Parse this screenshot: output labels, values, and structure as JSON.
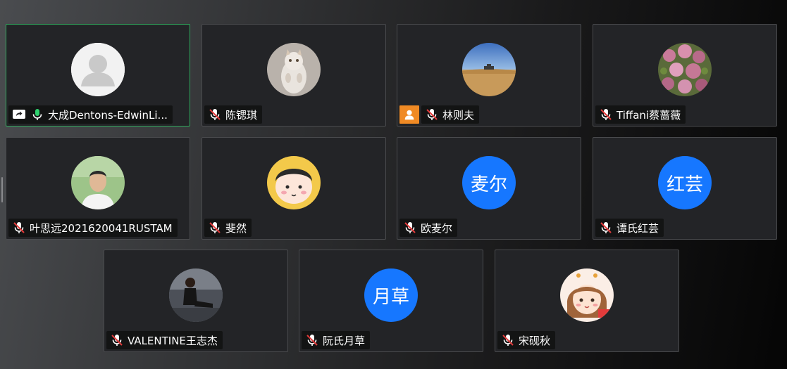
{
  "colors": {
    "tile_bg": "#232427",
    "active_border": "#2fa85c",
    "avatar_blue": "#1677ff",
    "host_orange": "#f08a24",
    "mic_green": "#2fd16e",
    "muted_red": "#e23b3b"
  },
  "participants": [
    {
      "name": "大成Dentons-EdwinLi...",
      "avatar_type": "default-user",
      "mic": "on",
      "sharing": true,
      "active": true
    },
    {
      "name": "陈锶琪",
      "avatar_type": "photo-cat",
      "mic": "muted"
    },
    {
      "name": "林则夫",
      "avatar_type": "photo-desert",
      "mic": "muted",
      "host_badge": true
    },
    {
      "name": "Tiffani蔡蔷薇",
      "avatar_type": "photo-flowers",
      "mic": "muted"
    },
    {
      "name": "叶思远2021620041RUSTAM",
      "avatar_type": "photo-man",
      "mic": "muted"
    },
    {
      "name": "斐然",
      "avatar_type": "cartoon-face",
      "mic": "muted"
    },
    {
      "name": "欧麦尔",
      "avatar_type": "initials",
      "avatar_text": "麦尔",
      "mic": "muted"
    },
    {
      "name": "谭氏红芸",
      "avatar_type": "initials",
      "avatar_text": "红芸",
      "mic": "muted"
    },
    {
      "name": "VALENTINE王志杰",
      "avatar_type": "photo-person-sofa",
      "mic": "muted"
    },
    {
      "name": "阮氏月草",
      "avatar_type": "initials",
      "avatar_text": "月草",
      "mic": "muted"
    },
    {
      "name": "宋砚秋",
      "avatar_type": "cartoon-girl",
      "mic": "muted"
    }
  ]
}
